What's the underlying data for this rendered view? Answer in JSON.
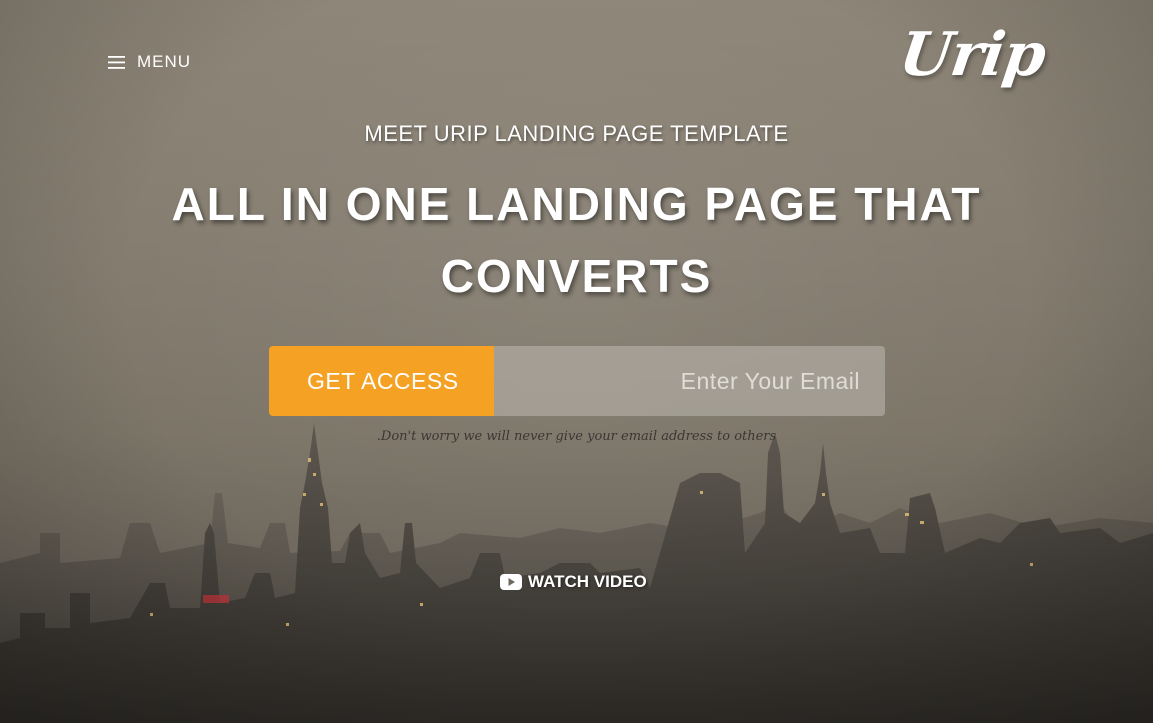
{
  "header": {
    "menu_label": "MENU",
    "menu_icon": "hamburger-icon",
    "logo_text": "Urip"
  },
  "hero": {
    "tagline": "MEET URIP LANDING PAGE TEMPLATE",
    "headline": "ALL IN ONE LANDING PAGE THAT CONVERTS",
    "cta_label": "GET ACCESS",
    "email_placeholder": "Enter Your Email",
    "disclaimer": ".Don't worry we will never give your email address to others",
    "watch_video_label": "WATCH VIDEO",
    "watch_video_icon": "play-video-icon"
  },
  "colors": {
    "accent": "#f5a123",
    "text": "#ffffff"
  }
}
